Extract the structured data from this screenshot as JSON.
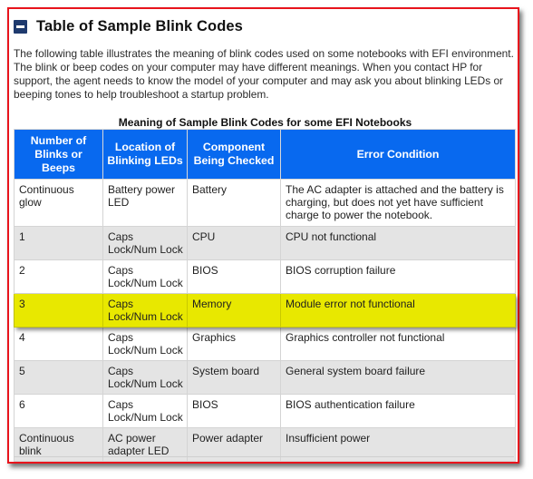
{
  "section": {
    "title": "Table of Sample Blink Codes",
    "collapse_icon": "minus-square-icon",
    "intro": "The following table illustrates the meaning of blink codes used on some notebooks with EFI environment. The blink or beep codes on your computer may have different meanings. When you contact HP for support, the agent needs to know the model of your computer and may ask you about blinking LEDs or beeping tones to help troubleshoot a startup problem."
  },
  "table": {
    "caption": "Meaning of Sample Blink Codes for some EFI Notebooks",
    "headers": [
      "Number of Blinks or Beeps",
      "Location of Blinking LEDs",
      "Component Being Checked",
      "Error Condition"
    ],
    "rows": [
      {
        "blinks": "Continuous glow",
        "location": "Battery power LED",
        "component": "Battery",
        "condition": "The AC adapter is attached and the battery is charging, but does not yet have sufficient charge to power the notebook."
      },
      {
        "blinks": "1",
        "location": "Caps Lock/Num Lock",
        "component": "CPU",
        "condition": "CPU not functional"
      },
      {
        "blinks": "2",
        "location": "Caps Lock/Num Lock",
        "component": "BIOS",
        "condition": "BIOS corruption failure"
      },
      {
        "blinks": "3",
        "location": "Caps Lock/Num Lock",
        "component": "Memory",
        "condition": "Module error not functional"
      },
      {
        "blinks": "4",
        "location": "Caps Lock/Num Lock",
        "component": "Graphics",
        "condition": "Graphics controller not functional"
      },
      {
        "blinks": "5",
        "location": "Caps Lock/Num Lock",
        "component": "System board",
        "condition": "General system board failure"
      },
      {
        "blinks": "6",
        "location": "Caps Lock/Num Lock",
        "component": "BIOS",
        "condition": "BIOS authentication failure"
      },
      {
        "blinks": "Continuous blink",
        "location": "AC power adapter LED",
        "component": "Power adapter",
        "condition": "Insufficient power"
      }
    ],
    "highlighted_row": "3"
  },
  "colors": {
    "frame_border": "#e8141c",
    "header_bg": "#0869ef",
    "highlight": "#e8e800",
    "alt_row": "#e4e4e4",
    "collapse_icon": "#1e3a6e"
  }
}
